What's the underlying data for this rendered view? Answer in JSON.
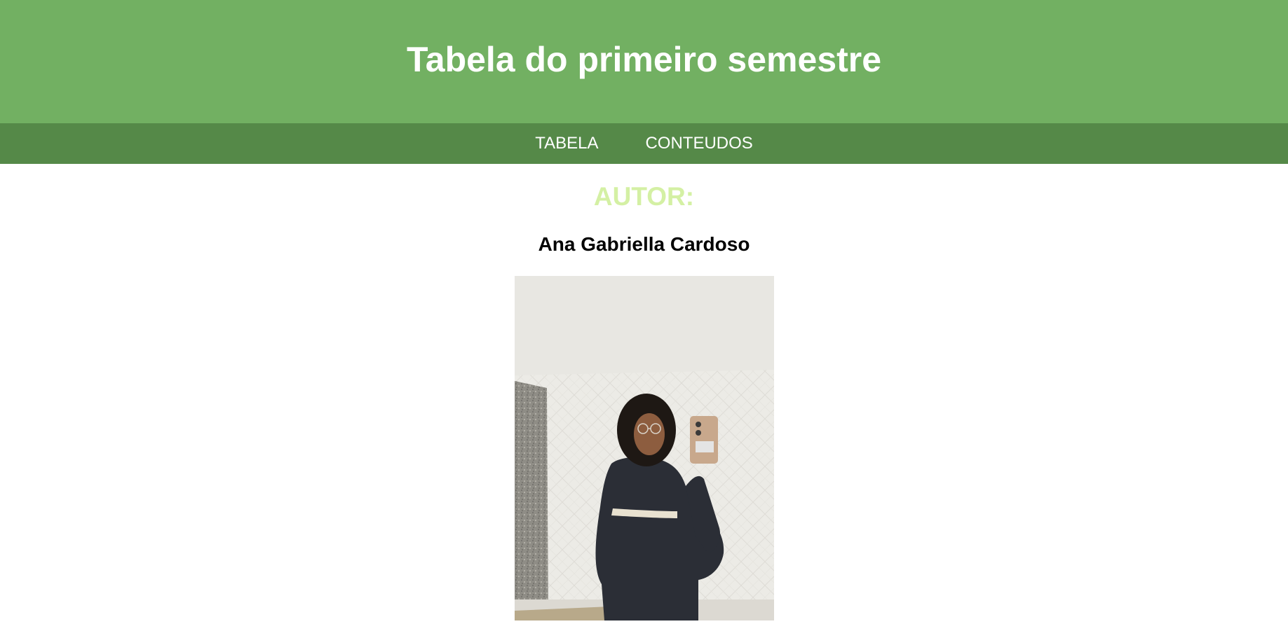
{
  "header": {
    "title": "Tabela do primeiro semestre"
  },
  "nav": {
    "items": [
      {
        "label": "TABELA"
      },
      {
        "label": "CONTEUDOS"
      }
    ]
  },
  "main": {
    "author_heading": "AUTOR:",
    "author_name": "Ana Gabriella Cardoso",
    "photo_alt": "Ana Gabriella Cardoso"
  },
  "colors": {
    "header_bg": "#72b062",
    "nav_bg": "#558948",
    "author_heading": "#d4f0a4"
  }
}
